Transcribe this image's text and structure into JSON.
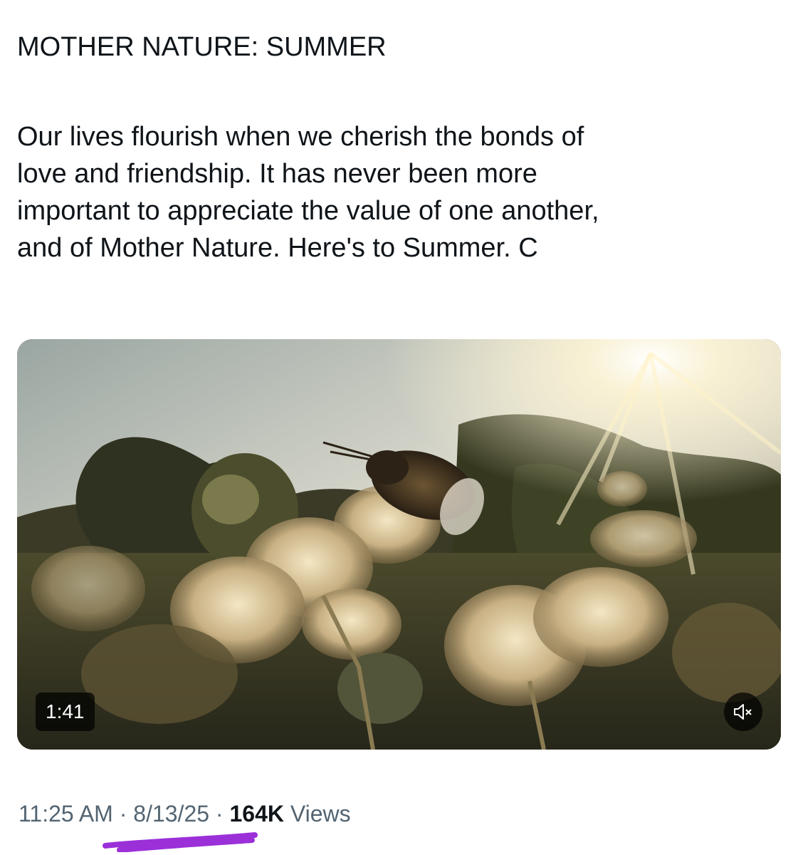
{
  "tweet": {
    "title": "MOTHER NATURE: SUMMER",
    "body_lines": [
      "Our lives flourish when we cherish the bonds of",
      "love and friendship. It has never been more",
      "important to appreciate the value of one another,",
      "and of Mother Nature. Here's to Summer. C"
    ]
  },
  "media": {
    "type": "video",
    "duration": "1:41",
    "muted": true,
    "mute_icon": "speaker-muted-icon"
  },
  "meta": {
    "time": "11:25 AM",
    "separator": "·",
    "date": "8/13/25",
    "views_count": "164K",
    "views_label": "Views"
  },
  "annotation": {
    "color": "#9b30d9"
  },
  "colors": {
    "text_primary": "#0f1419",
    "text_secondary": "#536471",
    "badge_bg": "rgba(0,0,0,0.72)"
  }
}
